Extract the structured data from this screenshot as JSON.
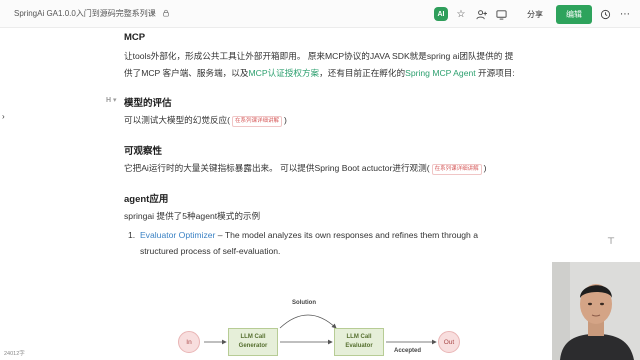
{
  "header": {
    "doc_title": "SpringAi GA1.0.0入门到源码完整系列课",
    "share_label": "分享",
    "edit_label": "编辑",
    "ai_label": "AI"
  },
  "content": {
    "mcp_heading": "MCP",
    "mcp_line1": "让tools外部化，形成公共工具让外部开箱即用。 原来MCP协议的JAVA SDK就是spring ai团队提供的 提",
    "mcp_line2_a": "供了MCP 客户端、服务端，以及",
    "mcp_line2_link1": "MCP认证授权方案",
    "mcp_line2_b": "，还有目前正在孵化的",
    "mcp_line2_link2": "Spring MCP Agent",
    "mcp_line2_c": " 开源项目:",
    "eval_heading": "模型的评估",
    "eval_handle": "H",
    "eval_line_a": "可以测试大模型的幻觉反应(",
    "eval_tag": "在系列课详细讲解",
    "eval_line_b": ")",
    "obs_heading": "可观察性",
    "obs_line_a": "它把Ai运行时的大量关键指标暴露出来。 可以提供Spring Boot actuctor进行观测(",
    "obs_tag": "在系列课详细讲解",
    "obs_line_b": ")",
    "agent_heading": "agent应用",
    "agent_intro": "springai 提供了5种agent模式的示例",
    "list_num": "1.",
    "list_link": "Evaluator Optimizer",
    "list_text": " – The model analyzes its own responses and refines them through a",
    "list_text2": "structured process of self-evaluation."
  },
  "diagram": {
    "in_label": "In",
    "gen_line1": "LLM Call",
    "gen_line2": "Generator",
    "eval_line1": "LLM Call",
    "eval_line2": "Evaluator",
    "out_label": "Out",
    "solution_label": "Solution",
    "accepted_label": "Accepted"
  },
  "footer": {
    "bottom_left": "24012字"
  }
}
